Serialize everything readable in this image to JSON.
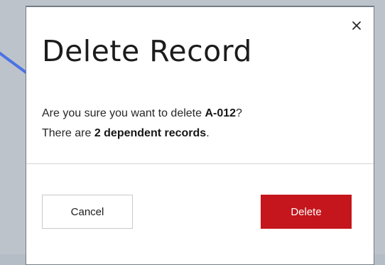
{
  "dialog": {
    "title": "Delete Record",
    "message": {
      "line1_prefix": "Are you sure you want to delete ",
      "record_id": "A-012",
      "line1_suffix": "?",
      "line2_prefix": "There are ",
      "dependent_count_text": "2 dependent records",
      "line2_suffix": "."
    },
    "close_icon": "close-icon",
    "buttons": {
      "cancel_label": "Cancel",
      "delete_label": "Delete"
    }
  },
  "colors": {
    "danger": "#c4161c",
    "annotation_arrow": "#4a72e6",
    "backdrop": "#bcc3cb"
  }
}
